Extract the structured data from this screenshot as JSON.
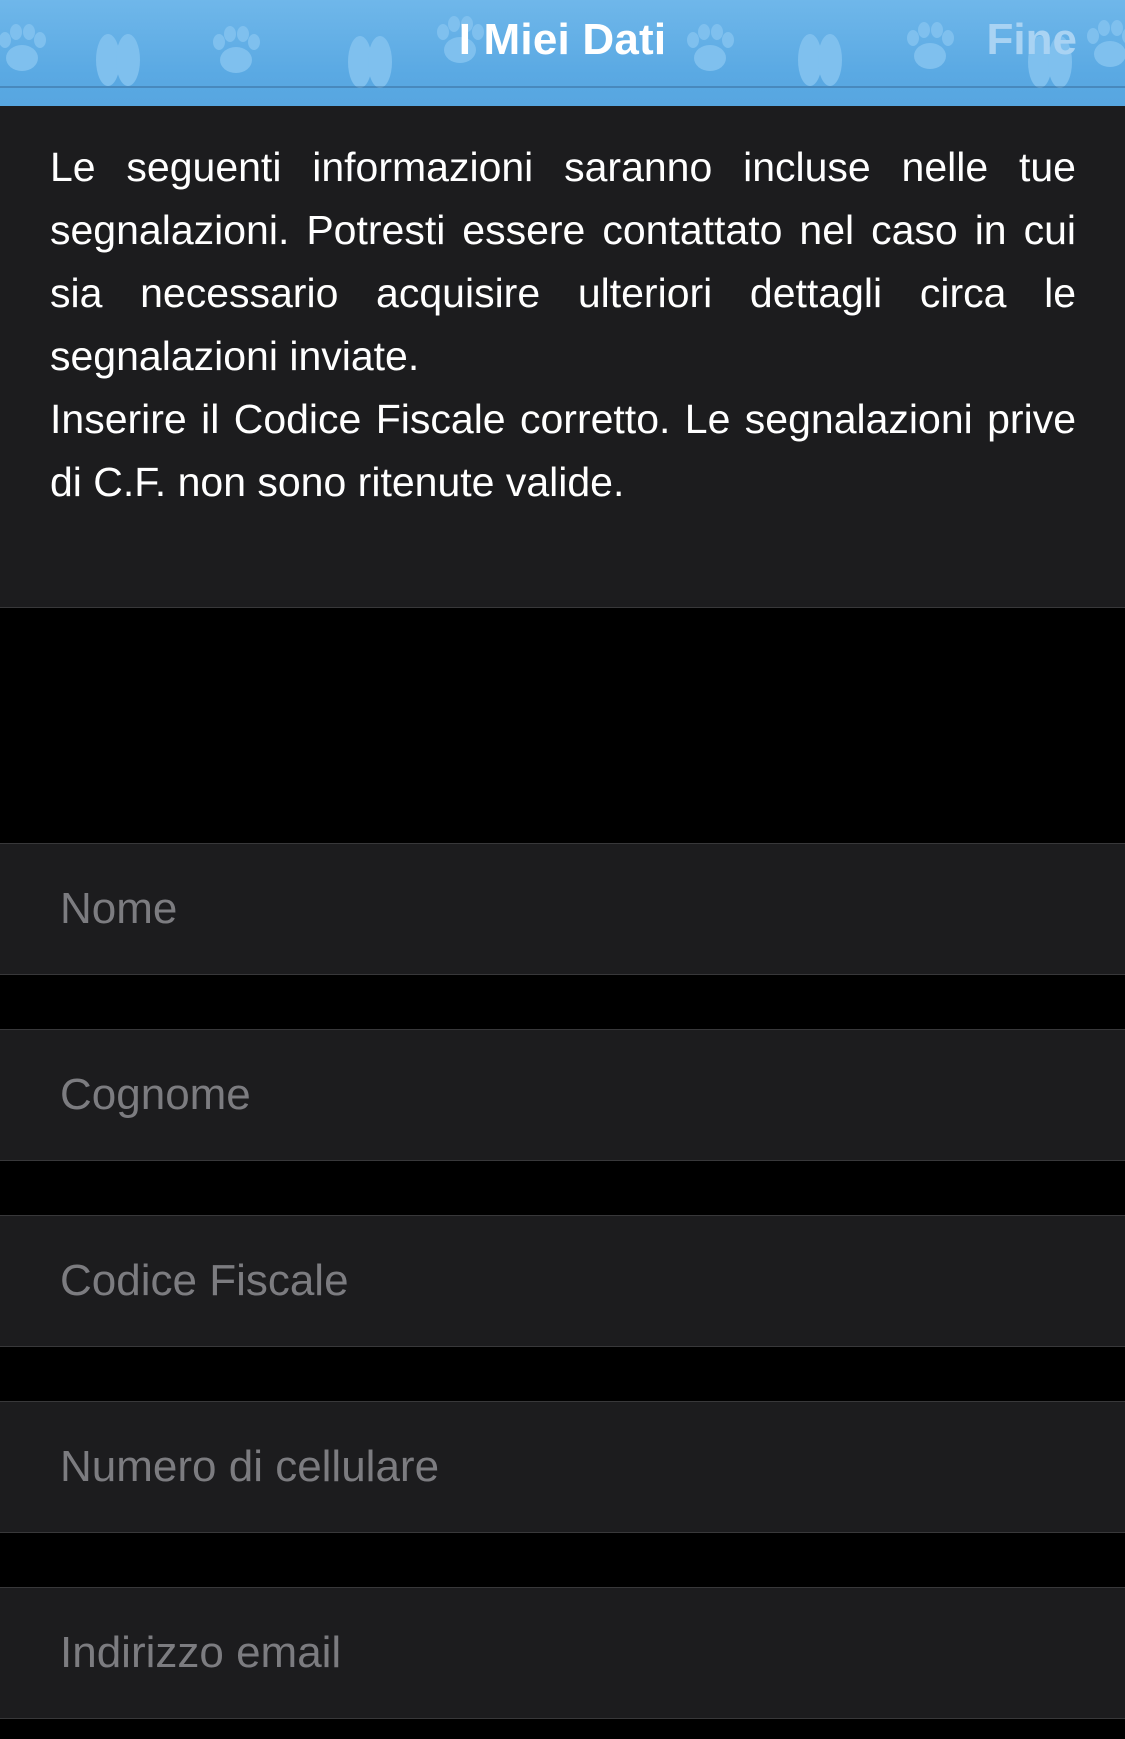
{
  "navbar": {
    "title": "I Miei Dati",
    "done_label": "Fine",
    "background_color": "#5aa9e3",
    "pattern_icon": "paw-print-icon"
  },
  "info": {
    "paragraph_1": "Le seguenti informazioni saranno incluse nelle tue segnalazioni. Potresti essere contattato nel caso in cui sia necessario acquisire ulteriori dettagli circa le segnalazioni inviate.",
    "paragraph_2": "Inserire il Codice Fiscale corretto. Le segnalazioni prive di C.F. non sono ritenute valide."
  },
  "form": {
    "nome": {
      "placeholder": "Nome",
      "value": ""
    },
    "cognome": {
      "placeholder": "Cognome",
      "value": ""
    },
    "codice_fiscale": {
      "placeholder": "Codice Fiscale",
      "value": ""
    },
    "cellulare": {
      "placeholder": "Numero di cellulare",
      "value": ""
    },
    "email": {
      "placeholder": "Indirizzo email",
      "value": ""
    }
  },
  "colors": {
    "panel_background": "#1c1c1e",
    "page_background": "#000000",
    "placeholder_text": "#7c7c80",
    "done_text": "#a9d3f3"
  }
}
